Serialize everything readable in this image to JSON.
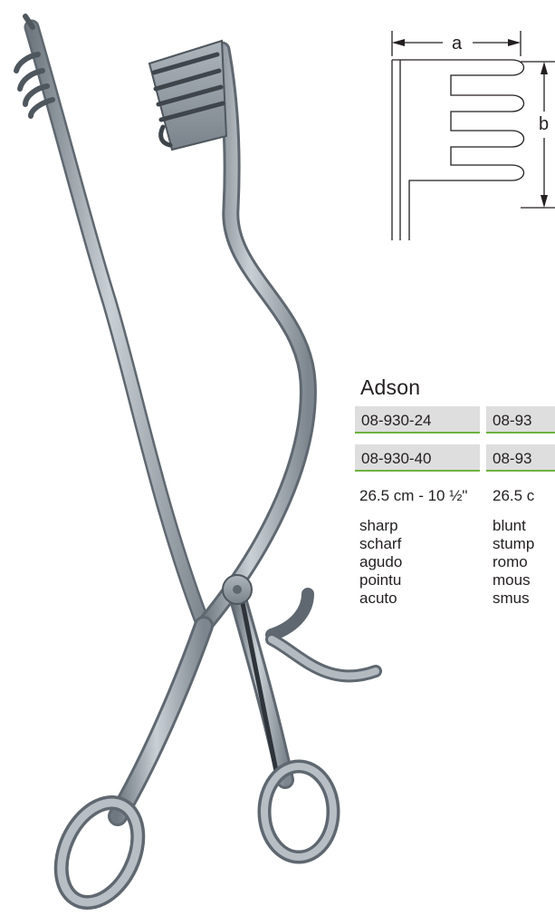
{
  "product": {
    "name": "Adson",
    "variants": [
      {
        "code_1": "08-930-24",
        "code_2": "08-930-40",
        "size": "26.5 cm - 10 ½\"",
        "tip": [
          "sharp",
          "scharf",
          "agudo",
          "pointu",
          "acuto"
        ]
      },
      {
        "code_1": "08-93",
        "code_2": "08-93",
        "size": "26.5 c",
        "tip": [
          "blunt",
          "stump",
          "romo",
          "mous",
          "smus"
        ]
      }
    ]
  },
  "diagram": {
    "label_a": "a",
    "label_b": "b"
  },
  "colors": {
    "row_bg": "#dedede",
    "row_underline": "#6cb33f",
    "steel": "#9ea6ad",
    "text": "#231f20"
  }
}
